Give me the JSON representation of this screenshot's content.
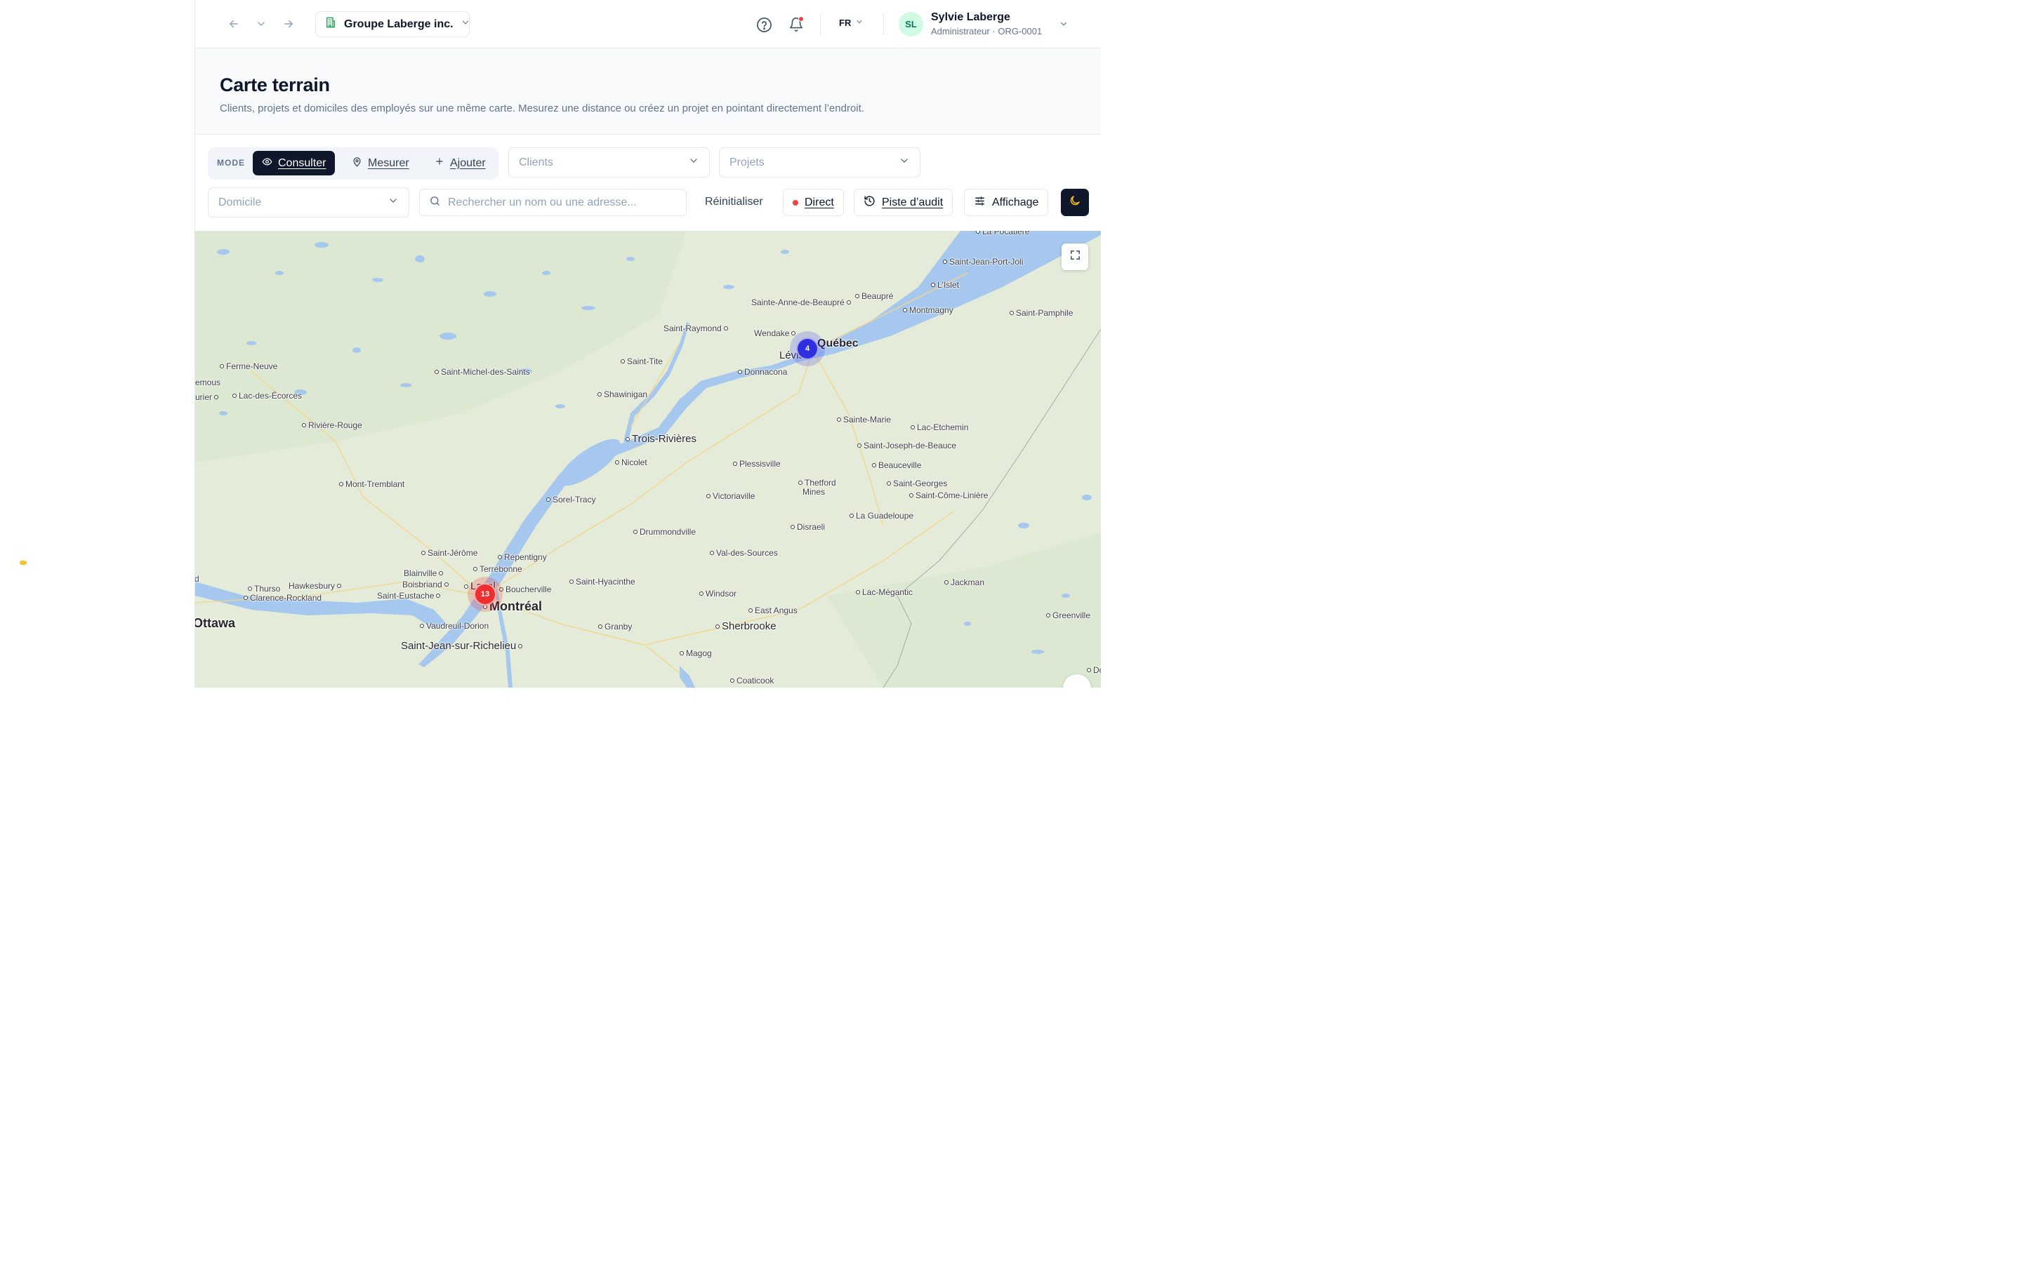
{
  "topbar": {
    "org_name": "Groupe Laberge inc.",
    "language": "FR",
    "user": {
      "initials": "SL",
      "name": "Sylvie Laberge",
      "role": "Administrateur · ORG-0001"
    }
  },
  "page": {
    "title": "Carte terrain",
    "subtitle": "Clients, projets et domiciles des employés sur une même carte. Mesurez une distance ou créez un projet en pointant directement l’endroit."
  },
  "toolbar": {
    "mode_label": "MODE",
    "modes": [
      {
        "label": "Consulter",
        "active": true
      },
      {
        "label": "Mesurer",
        "active": false
      },
      {
        "label": "Ajouter",
        "active": false
      }
    ],
    "clients_placeholder": "Clients",
    "projects_placeholder": "Projets",
    "domicile_placeholder": "Domicile",
    "search_placeholder": "Rechercher un nom ou une adresse...",
    "reset_label": "Réinitialiser",
    "live_label": "Direct",
    "audit_label": "Piste d’audit",
    "display_label": "Affichage"
  },
  "map": {
    "clusters": [
      {
        "name": "Québec",
        "count": "4",
        "color": "#2f2fe0"
      },
      {
        "name": "Montréal",
        "count": "13",
        "color": "#ef2f2f"
      }
    ],
    "cities": [
      "La Pocatière",
      "Saint-Jean-Port-Joli",
      "L'Islet",
      "Beaupré",
      "Sainte-Anne-de-Beaupré",
      "Montmagny",
      "Saint-Pamphile",
      "Saint-Raymond",
      "Wendake",
      "Québec",
      "Lévis",
      "Saint-Tite",
      "Donnacona",
      "Ferme-Neuve",
      "Saint-Michel-des-Saints",
      "emous",
      "urier",
      "Lac-des-Écorces",
      "Shawinigan",
      "Rivière-Rouge",
      "Sainte-Marie",
      "Lac-Etchemin",
      "Trois-Rivières",
      "Saint-Joseph-de-Beauce",
      "Nicolet",
      "Plessisville",
      "Beauceville",
      "Mont-Tremblant",
      "Thetford",
      "Mines",
      "Saint-Georges",
      "Sorel-Tracy",
      "Victoriaville",
      "Saint-Côme-Linière",
      "La Guadeloupe",
      "Disraeli",
      "Drummondville",
      "Saint-Jérôme",
      "Repentigny",
      "Val-des-Sources",
      "Blainville",
      "Terrebonne",
      "Boisbriand",
      "Laval",
      "Boucherville",
      "Saint-Hyacinthe",
      "Jackman",
      "Thurso",
      "Hawkesbury",
      "Saint-Eustache",
      "Lac-Mégantic",
      "Clarence-Rockland",
      "Windsor",
      "Montréal",
      "East Angus",
      "Greenville",
      "Ottawa",
      "Vaudreuil-Dorion",
      "Granby",
      "Sherbrooke",
      "Saint-Jean-sur-Richelieu",
      "Magog",
      "Coaticook",
      "Do",
      "d"
    ]
  },
  "colors": {
    "primary_dark": "#0f172a",
    "water": "#a6c8ee",
    "land": "#e4ecd9",
    "live_dot": "#ef4444"
  }
}
